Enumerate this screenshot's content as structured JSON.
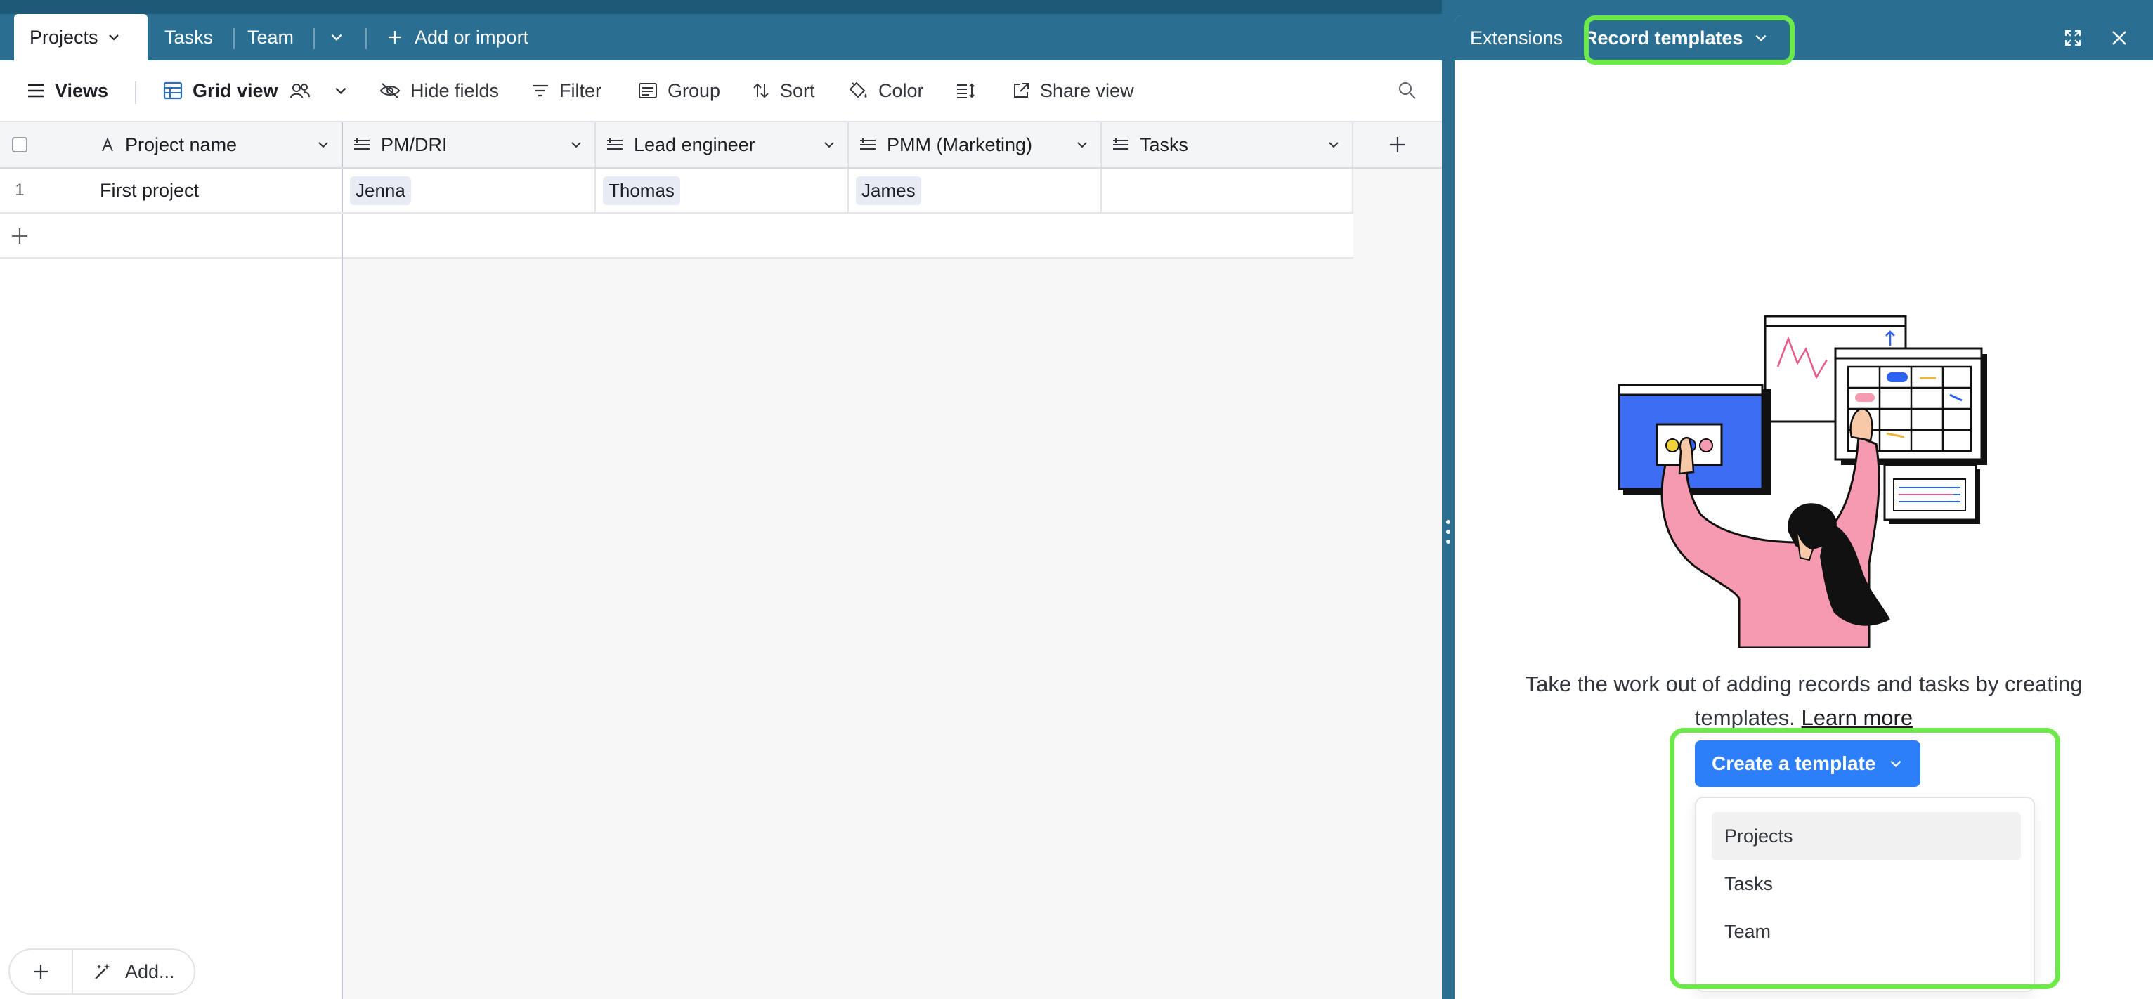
{
  "table_tabs": {
    "items": [
      {
        "label": "Projects"
      },
      {
        "label": "Tasks"
      },
      {
        "label": "Team"
      }
    ],
    "add_label": "Add or import"
  },
  "toolbar": {
    "views_label": "Views",
    "view_name": "Grid view",
    "hide_fields_label": "Hide fields",
    "filter_label": "Filter",
    "group_label": "Group",
    "sort_label": "Sort",
    "color_label": "Color",
    "share_label": "Share view"
  },
  "grid": {
    "columns": [
      {
        "label": "Project name",
        "icon": "text-a-icon"
      },
      {
        "label": "PM/DRI",
        "icon": "link-field-icon"
      },
      {
        "label": "Lead engineer",
        "icon": "link-field-icon"
      },
      {
        "label": "PMM (Marketing)",
        "icon": "link-field-icon"
      },
      {
        "label": "Tasks",
        "icon": "link-field-icon"
      }
    ],
    "rows": [
      {
        "number": "1",
        "project_name": "First project",
        "pm": "Jenna",
        "lead": "Thomas",
        "pmm": "James",
        "tasks": ""
      }
    ]
  },
  "bottom_bar": {
    "add_label": "Add..."
  },
  "side_panel": {
    "tabs": [
      {
        "label": "Extensions"
      },
      {
        "label": "Record templates"
      }
    ],
    "description": "Take the work out of adding records and tasks by creating",
    "description_line2": "templates.",
    "learn_more": "Learn more",
    "create_button": "Create a template",
    "menu_items": [
      {
        "label": "Projects"
      },
      {
        "label": "Tasks"
      },
      {
        "label": "Team"
      }
    ]
  },
  "colors": {
    "header_blue": "#2a6f91",
    "primary_button": "#2d7ff9",
    "highlight_green": "#6ee94a",
    "illustration_blue": "#3d6df2",
    "illustration_pink": "#f59ab0"
  }
}
